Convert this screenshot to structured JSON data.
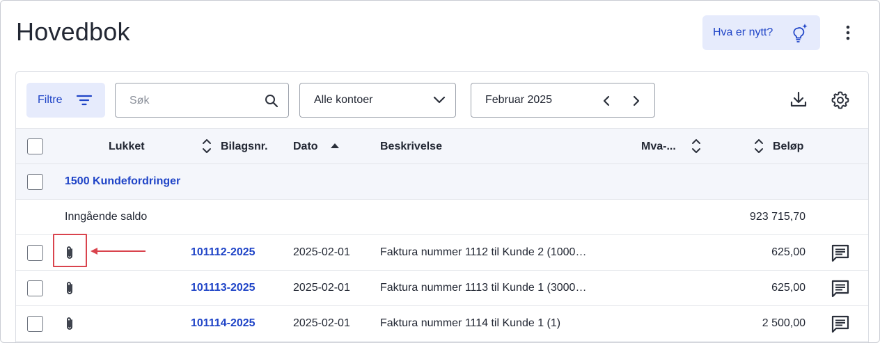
{
  "page": {
    "title": "Hovedbok"
  },
  "header": {
    "news_label": "Hva er nytt?"
  },
  "toolbar": {
    "filter_label": "Filtre",
    "search_placeholder": "Søk",
    "search_value": "",
    "account_select": "Alle kontoer",
    "period": "Februar 2025"
  },
  "table": {
    "columns": {
      "closed": "Lukket",
      "voucher": "Bilagsnr.",
      "date": "Dato",
      "description": "Beskrivelse",
      "vat": "Mva-...",
      "amount": "Beløp"
    },
    "group": {
      "label": "1500 Kundefordringer"
    },
    "opening": {
      "label": "Inngående saldo",
      "amount": "923 715,70"
    },
    "rows": [
      {
        "voucher": "101112-2025",
        "date": "2025-02-01",
        "description": "Faktura nummer 1112 til Kunde 2 (1000…",
        "amount": "625,00"
      },
      {
        "voucher": "101113-2025",
        "date": "2025-02-01",
        "description": "Faktura nummer 1113 til Kunde 1 (3000…",
        "amount": "625,00"
      },
      {
        "voucher": "101114-2025",
        "date": "2025-02-01",
        "description": "Faktura nummer 1114 til Kunde 1 (1)",
        "amount": "2 500,00"
      }
    ]
  },
  "colors": {
    "accent": "#1f44c7",
    "accent_bg": "#e6ebfc",
    "highlight": "#d9434d",
    "header_bg": "#f4f6fb"
  },
  "icons": [
    "bulb-sparkle-icon",
    "kebab-menu-icon",
    "filter-lines-icon",
    "search-icon",
    "chevron-down-icon",
    "chevron-left-icon",
    "chevron-right-icon",
    "download-icon",
    "gear-icon",
    "sort-icon",
    "sort-ascending-icon",
    "paperclip-icon",
    "comment-icon"
  ]
}
